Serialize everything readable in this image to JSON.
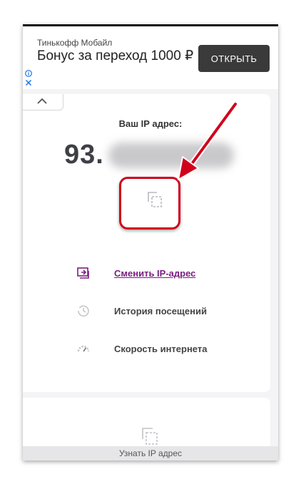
{
  "ad": {
    "brand": "Тинькофф Мобайл",
    "title": "Бонус за переход 1000 ₽",
    "button_label": "ОТКРЫТЬ",
    "info_icon": "info-icon",
    "close_icon": "close-icon"
  },
  "ip_panel": {
    "label": "Ваш IP адрес:",
    "ip_prefix": "93.",
    "copy_icon": "copy-icon"
  },
  "menu": [
    {
      "label": "Сменить IP-адрес",
      "icon": "change-ip-icon"
    },
    {
      "label": "История посещений",
      "icon": "history-icon"
    },
    {
      "label": "Скорость интернета",
      "icon": "speedometer-icon"
    }
  ],
  "bottom_nav": {
    "label": "Узнать IP адрес",
    "icon": "copy-icon"
  },
  "colors": {
    "accent": "#7a1e82",
    "highlight": "#d0021b",
    "ad_button": "#3a3a3a",
    "info": "#1a73e8"
  }
}
